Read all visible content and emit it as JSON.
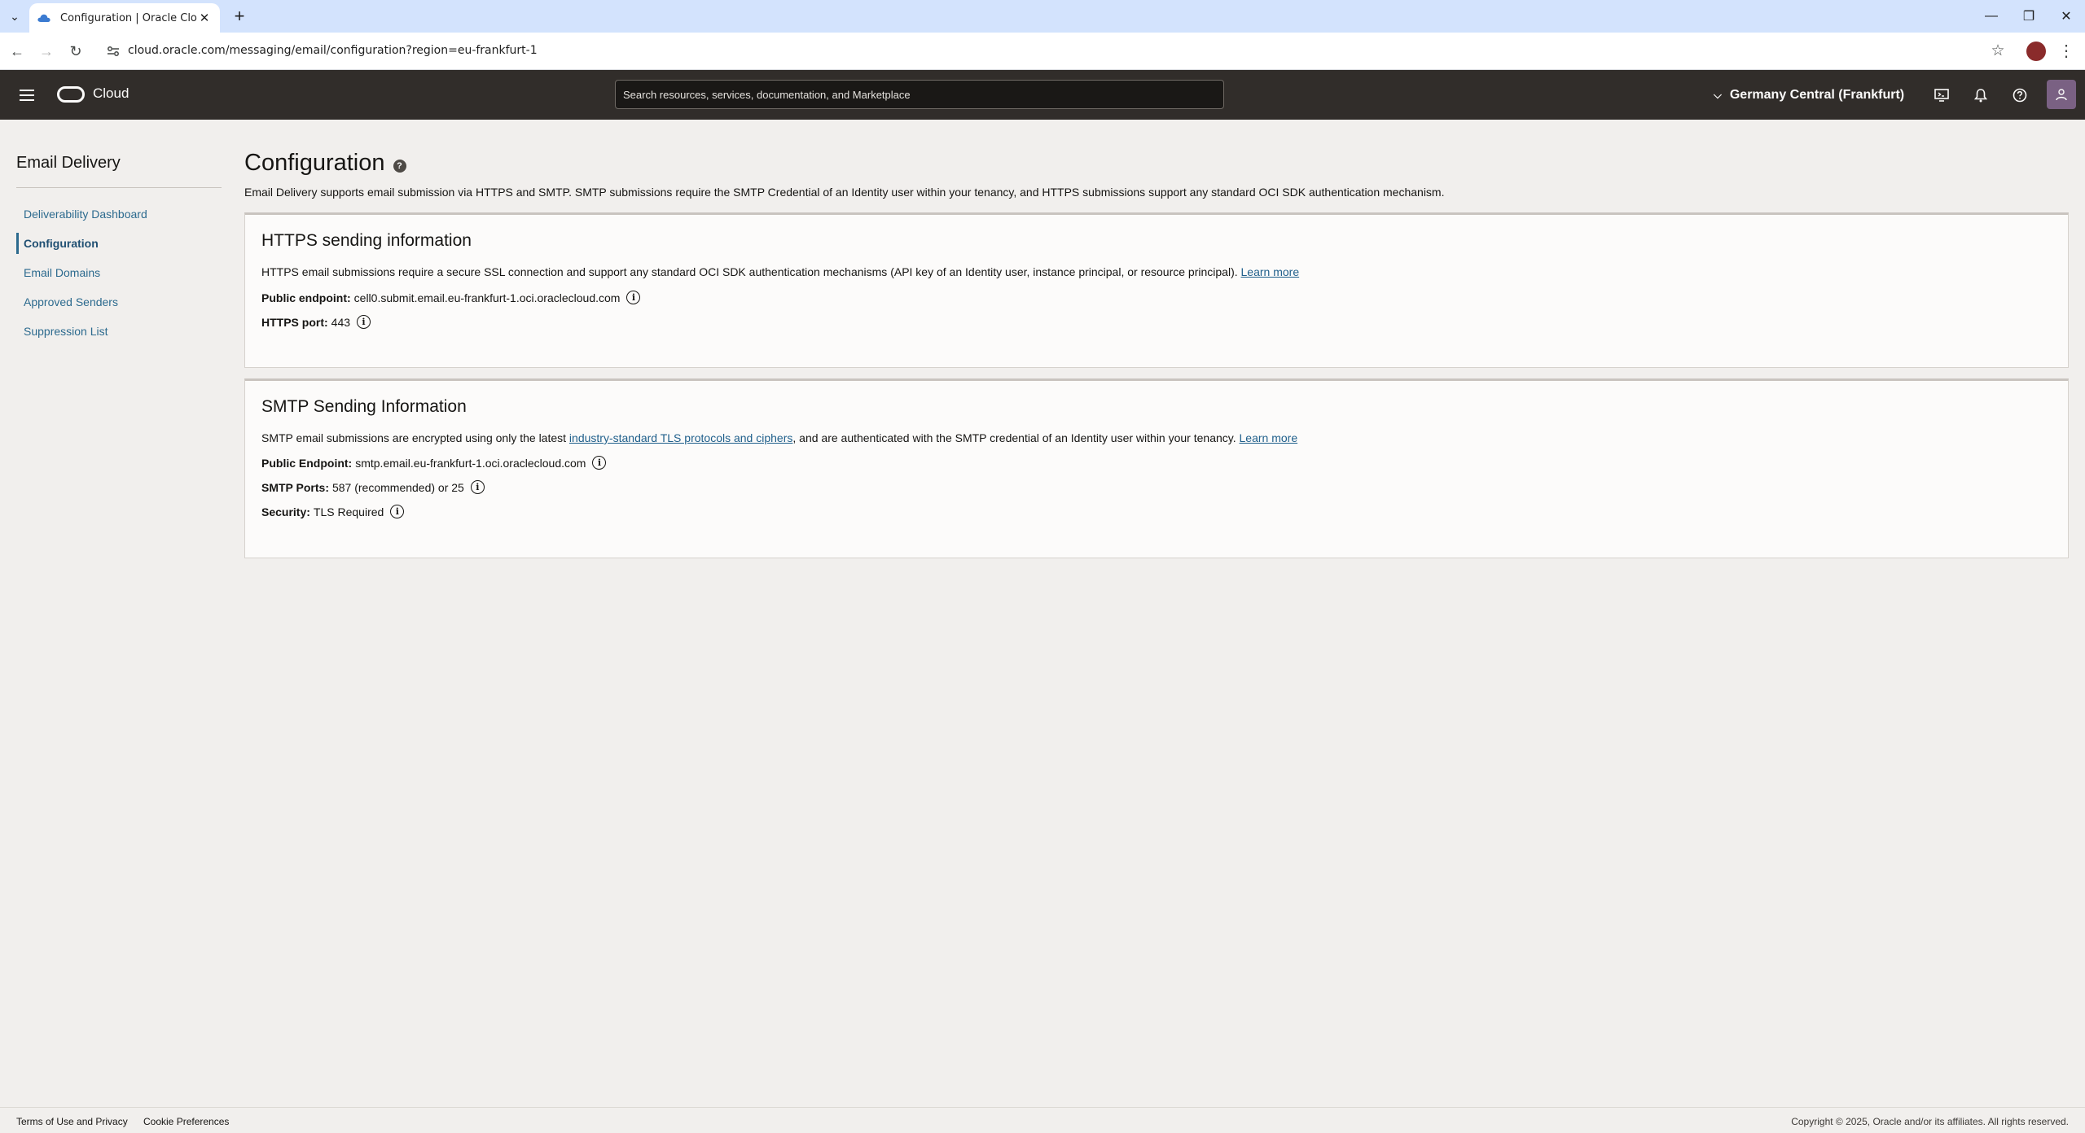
{
  "browser": {
    "tab_title": "Configuration | Oracle Cloud In",
    "url": "cloud.oracle.com/messaging/email/configuration?region=eu-frankfurt-1"
  },
  "header": {
    "brand": "Cloud",
    "search_placeholder": "Search resources, services, documentation, and Marketplace",
    "region": "Germany Central (Frankfurt)"
  },
  "sidenav": {
    "title": "Email Delivery",
    "items": [
      {
        "label": "Deliverability Dashboard",
        "active": false
      },
      {
        "label": "Configuration",
        "active": true
      },
      {
        "label": "Email Domains",
        "active": false
      },
      {
        "label": "Approved Senders",
        "active": false
      },
      {
        "label": "Suppression List",
        "active": false
      }
    ]
  },
  "page": {
    "title": "Configuration",
    "description": "Email Delivery supports email submission via HTTPS and SMTP. SMTP submissions require the SMTP Credential of an Identity user within your tenancy, and HTTPS submissions support any standard OCI SDK authentication mechanism."
  },
  "https_card": {
    "title": "HTTPS sending information",
    "description": "HTTPS email submissions require a secure SSL connection and support any standard OCI SDK authentication mechanisms (API key of an Identity user, instance principal, or resource principal).",
    "learn_more": "Learn more",
    "endpoint_label": "Public endpoint:",
    "endpoint_value": "cell0.submit.email.eu-frankfurt-1.oci.oraclecloud.com",
    "port_label": "HTTPS port:",
    "port_value": "443"
  },
  "smtp_card": {
    "title": "SMTP Sending Information",
    "description_pre": "SMTP email submissions are encrypted using only the latest",
    "description_link": "industry-standard TLS protocols and ciphers",
    "description_post": ", and are authenticated with the SMTP credential of an Identity user within your tenancy.",
    "learn_more": "Learn more",
    "endpoint_label": "Public Endpoint:",
    "endpoint_value": "smtp.email.eu-frankfurt-1.oci.oraclecloud.com",
    "ports_label": "SMTP Ports:",
    "ports_value": "587 (recommended) or 25",
    "security_label": "Security:",
    "security_value": "TLS Required"
  },
  "footer": {
    "terms": "Terms of Use and Privacy",
    "cookies": "Cookie Preferences",
    "copyright": "Copyright © 2025, Oracle and/or its affiliates. All rights reserved."
  }
}
